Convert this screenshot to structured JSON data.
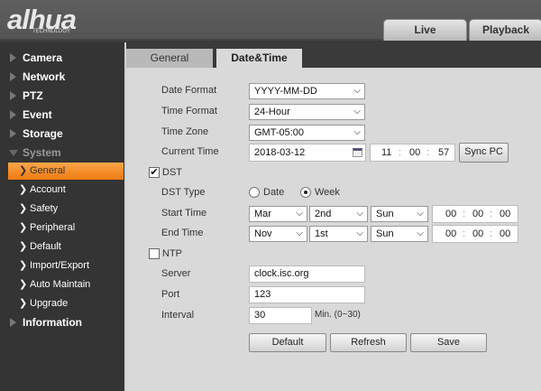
{
  "header": {
    "logo": "alhua",
    "logo_sub": "TECHNOLOGY",
    "tabs": [
      "Live",
      "Playback"
    ]
  },
  "sidebar": {
    "sections": [
      "Camera",
      "Network",
      "PTZ",
      "Event",
      "Storage",
      "System",
      "Information"
    ],
    "system_items": [
      "General",
      "Account",
      "Safety",
      "Peripheral",
      "Default",
      "Import/Export",
      "Auto Maintain",
      "Upgrade"
    ],
    "active": "General"
  },
  "tabs": [
    "General",
    "Date&Time"
  ],
  "active_tab": "Date&Time",
  "form": {
    "date_format": {
      "label": "Date Format",
      "value": "YYYY-MM-DD"
    },
    "time_format": {
      "label": "Time Format",
      "value": "24-Hour"
    },
    "time_zone": {
      "label": "Time Zone",
      "value": "GMT-05:00"
    },
    "current_time": {
      "label": "Current Time",
      "date": "2018-03-12",
      "h": "11",
      "m": "00",
      "s": "57",
      "sync": "Sync PC"
    },
    "dst": {
      "label": "DST",
      "checked": true
    },
    "dst_type": {
      "label": "DST Type",
      "options": [
        "Date",
        "Week"
      ],
      "selected": "Week"
    },
    "start_time": {
      "label": "Start Time",
      "month": "Mar",
      "week": "2nd",
      "day": "Sun",
      "h": "00",
      "m": "00",
      "s": "00"
    },
    "end_time": {
      "label": "End Time",
      "month": "Nov",
      "week": "1st",
      "day": "Sun",
      "h": "00",
      "m": "00",
      "s": "00"
    },
    "ntp": {
      "label": "NTP",
      "checked": false
    },
    "server": {
      "label": "Server",
      "value": "clock.isc.org"
    },
    "port": {
      "label": "Port",
      "value": "123"
    },
    "interval": {
      "label": "Interval",
      "value": "30",
      "hint": "Min. (0~30)"
    },
    "sep": ":",
    "check": "✔",
    "chev": "❯",
    "arrow": "⌵"
  },
  "buttons": {
    "default": "Default",
    "refresh": "Refresh",
    "save": "Save"
  }
}
